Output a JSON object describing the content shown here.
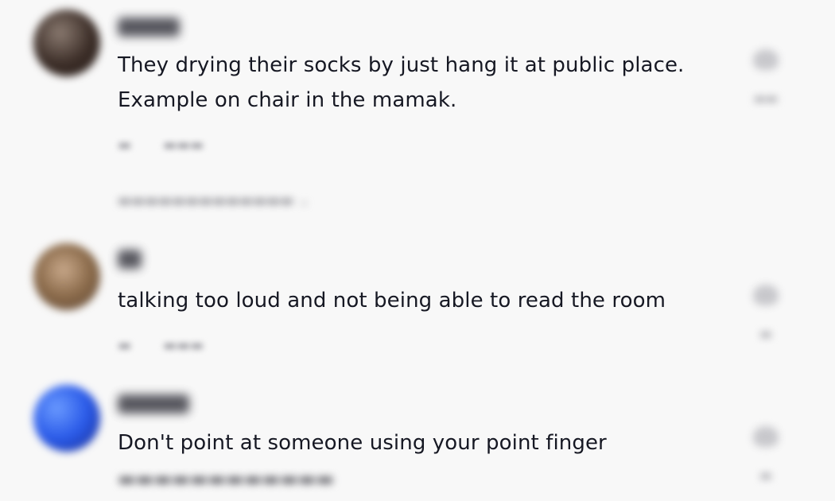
{
  "comments": [
    {
      "username": "",
      "text_line1": "They drying their socks by just hang it at public place.",
      "text_line2": "Example on chair in the mamak.",
      "avatar_color": "#4a3a32"
    },
    {
      "username": "",
      "text_line1": "talking too loud and not being able to read the room",
      "avatar_color": "#8a6a4a"
    },
    {
      "username": "",
      "text_line1": "Don't point at someone using your point finger",
      "avatar_color": "#2a5ae8"
    }
  ]
}
